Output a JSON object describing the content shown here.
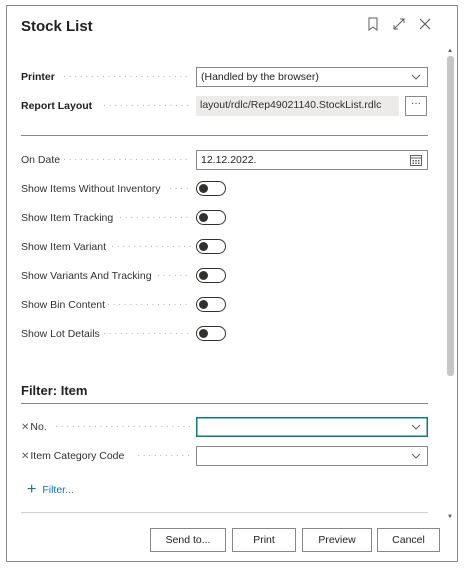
{
  "dialog": {
    "title": "Stock List"
  },
  "printer": {
    "label": "Printer",
    "value": "(Handled by the browser)"
  },
  "report_layout": {
    "label": "Report Layout",
    "value": "layout/rdlc/Rep49021140.StockList.rdlc",
    "more_label": "···"
  },
  "options": {
    "on_date": {
      "label": "On Date",
      "value": "12.12.2022."
    },
    "toggles": [
      {
        "label": "Show Items Without Inventory",
        "value": false
      },
      {
        "label": "Show Item Tracking",
        "value": false
      },
      {
        "label": "Show Item Variant",
        "value": false
      },
      {
        "label": "Show Variants And Tracking",
        "value": false
      },
      {
        "label": "Show Bin Content",
        "value": false
      },
      {
        "label": "Show Lot Details",
        "value": false
      }
    ]
  },
  "filter_section": {
    "title": "Filter: Item",
    "filters": [
      {
        "label": "No.",
        "value": ""
      },
      {
        "label": "Item Category Code",
        "value": ""
      }
    ],
    "add_filter_label": "Filter..."
  },
  "footer": {
    "send_to": "Send to...",
    "print": "Print",
    "preview": "Preview",
    "cancel": "Cancel"
  },
  "colors": {
    "accent": "#0f7b7d",
    "border": "#8a8886"
  }
}
